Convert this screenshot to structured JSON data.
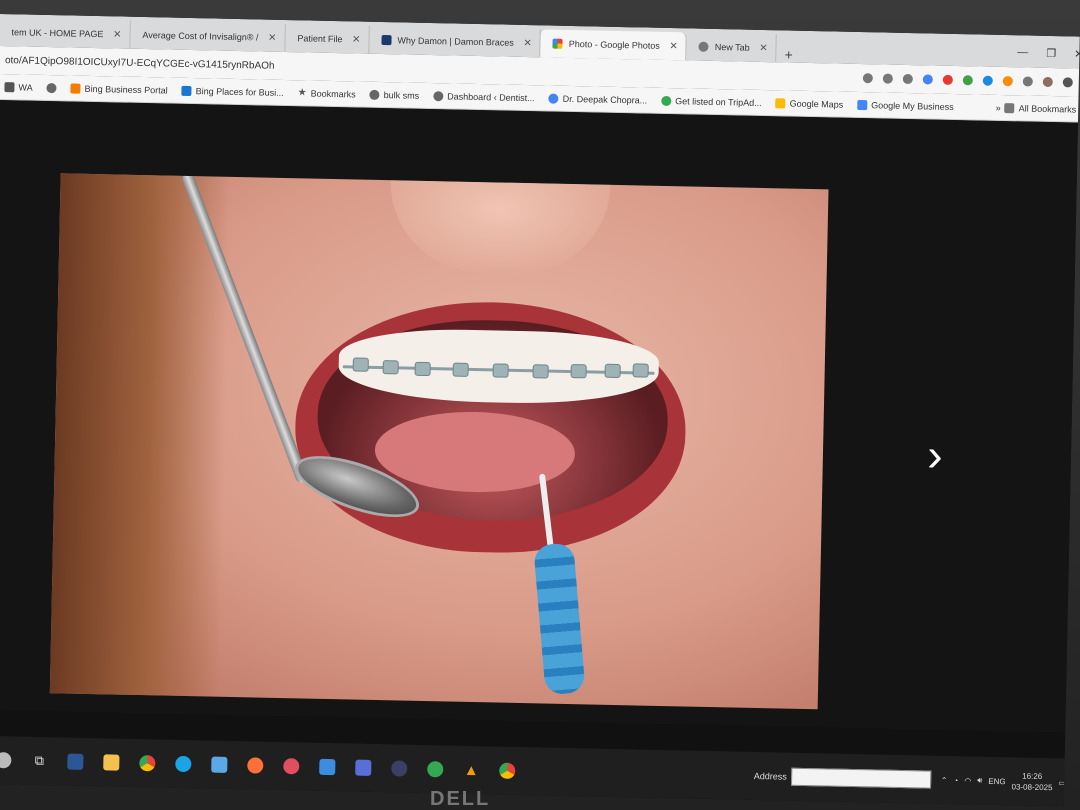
{
  "tabs": [
    {
      "label": "tem UK - HOME PAGE",
      "active": false
    },
    {
      "label": "Average Cost of Invisalign® /",
      "active": false
    },
    {
      "label": "Patient File",
      "active": false
    },
    {
      "label": "Why Damon | Damon Braces",
      "active": false
    },
    {
      "label": "Photo - Google Photos",
      "active": true
    },
    {
      "label": "New Tab",
      "active": false
    }
  ],
  "address_bar": {
    "url": "oto/AF1QipO98I1OICUxyI7U-ECqYCGEc-vG1415rynRbAOh"
  },
  "bookmarks": [
    {
      "label": "WA",
      "icon": "folder-icon",
      "color": "#555555"
    },
    {
      "label": "",
      "icon": "globe-icon",
      "color": "#666666"
    },
    {
      "label": "Bing Business Portal",
      "icon": "bing-icon",
      "color": "#f57c00"
    },
    {
      "label": "Bing Places for Busi...",
      "icon": "bing-icon",
      "color": "#1976d2"
    },
    {
      "label": "Bookmarks",
      "icon": "star-icon",
      "color": "#555555"
    },
    {
      "label": "bulk sms",
      "icon": "globe-icon",
      "color": "#666666"
    },
    {
      "label": "Dashboard ‹ Dentist...",
      "icon": "globe-icon",
      "color": "#666666"
    },
    {
      "label": "Dr. Deepak Chopra...",
      "icon": "google-icon",
      "color": "#4285f4"
    },
    {
      "label": "Get listed on TripAd...",
      "icon": "tripadvisor-icon",
      "color": "#34a853"
    },
    {
      "label": "Google Maps",
      "icon": "maps-icon",
      "color": "#fbbc05"
    },
    {
      "label": "Google My Business",
      "icon": "business-icon",
      "color": "#4285f4"
    }
  ],
  "all_bookmarks_label": "All Bookmarks",
  "taskbar": {
    "address_label": "Address",
    "address_value": "",
    "lang": "ENG",
    "time": "16:26",
    "date": "03-08-2025"
  }
}
